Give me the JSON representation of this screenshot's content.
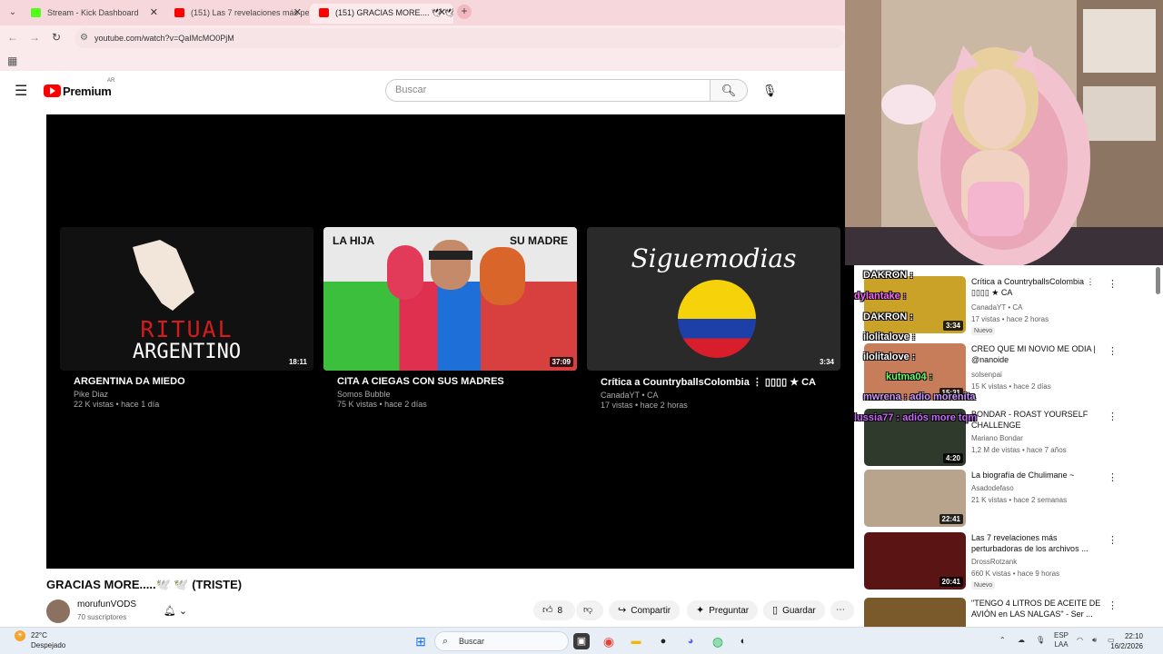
{
  "browser": {
    "tabs": [
      {
        "label": "Stream - Kick Dashboard",
        "color": "#53fc18"
      },
      {
        "label": "(151) Las 7 revelaciones más pe",
        "color": "#ff0000"
      },
      {
        "label": "(151) GRACIAS MORE.... 🕊 🕊",
        "color": "#ff0000"
      }
    ],
    "new_tab": "+",
    "url": "youtube.com/watch?v=QaIMcMO0PjM"
  },
  "youtube": {
    "logo_word": "Premium",
    "logo_region": "AR",
    "search_placeholder": "Buscar"
  },
  "endscreen": [
    {
      "overlay": [
        "RITUAL",
        "ARGENTINO"
      ],
      "duration": "18:11",
      "title": "ARGENTINA DA MIEDO",
      "channel": "Pike Diaz",
      "meta": "22 K vistas • hace 1 día"
    },
    {
      "overlay": [
        "LA HIJA",
        "SU MADRE"
      ],
      "duration": "37:09",
      "title": "CITA A CIEGAS CON SUS MADRES",
      "channel": "Somos Bubble",
      "meta": "75 K vistas • hace 2 días"
    },
    {
      "overlay": [
        "Siguemodias"
      ],
      "duration": "3:34",
      "title": "Crítica a CountryballsColombia ⋮ ▯▯▯▯ ★ CA",
      "channel": "CanadaYT • CA",
      "meta": "17 vistas • hace 2 horas"
    }
  ],
  "video": {
    "title": "GRACIAS MORE.....🕊️ 🕊️ (TRISTE)",
    "channel": "morufunVODS",
    "subscribers": "70 suscriptores",
    "likes": "8",
    "share": "Compartir",
    "ask": "Preguntar",
    "save": "Guardar"
  },
  "sidebar": [
    {
      "title": "Crítica a CountryballsColombia ⋮ ▯▯▯▯ ★ CA",
      "channel": "CanadaYT • CA",
      "meta": "17 vistas • hace 2 horas",
      "badge": "Nuevo",
      "duration": "3:34",
      "thumb": "#c9a227"
    },
    {
      "title": "CREO QUE MI NOVIO ME ODIA | @nanoide",
      "channel": "solsenpai",
      "meta": "15 K vistas • hace 2 días",
      "badge": "",
      "duration": "15:31",
      "thumb": "#c77d5a"
    },
    {
      "title": "BONDAR - ROAST YOURSELF CHALLENGE",
      "channel": "Mariano Bondar",
      "meta": "1,2 M de vistas • hace 7 años",
      "badge": "",
      "duration": "4:20",
      "thumb": "#2f3a2c"
    },
    {
      "title": "La biografía de Chulimane ~",
      "channel": "Asadodefaso",
      "meta": "21 K vistas • hace 2 semanas",
      "badge": "",
      "duration": "22:41",
      "thumb": "#b8a38d"
    },
    {
      "title": "Las 7 revelaciones más perturbadoras de los archivos ...",
      "channel": "DrossRotzank",
      "meta": "660 K vistas • hace 9 horas",
      "badge": "Nuevo",
      "duration": "20:41",
      "thumb": "#5a1414"
    },
    {
      "title": "\"TENGO 4 LITROS DE ACEITE DE AVIÓN en LAS NALGAS\" - Ser ...",
      "channel": "",
      "meta": "",
      "badge": "",
      "duration": "",
      "thumb": "#7a5a2a"
    }
  ],
  "chat": [
    {
      "text": "DAKRON :",
      "color": "#ffffff"
    },
    {
      "text": "dylantake :",
      "color": "#ff66ff"
    },
    {
      "text": "DAKRON :",
      "color": "#ffffff"
    },
    {
      "text": "ilolitalove :",
      "color": "#ffffff"
    },
    {
      "text": "ilolitalove :",
      "color": "#ffffff"
    },
    {
      "text": "kutma04 :",
      "color": "#66ff66"
    },
    {
      "text": "mwrena : adio morenita",
      "color": "#cc99ff"
    },
    {
      "text": "lussia77 : adiós more tqm",
      "color": "#cc66ff"
    }
  ],
  "taskbar": {
    "temp": "22°C",
    "weather": "Despejado",
    "search": "Buscar",
    "lang": "ESP",
    "lang2": "LAA",
    "time": "22:10",
    "date": "16/2/2026"
  },
  "icons": {
    "tab_dropdown": "chevron-down-icon",
    "back": "back-arrow-icon",
    "forward": "forward-arrow-icon",
    "reload": "reload-icon",
    "menu": "menu-icon",
    "search": "search-icon",
    "mic": "mic-icon",
    "bell": "bell-icon",
    "like": "thumbs-up-icon",
    "dislike": "thumbs-down-icon"
  }
}
